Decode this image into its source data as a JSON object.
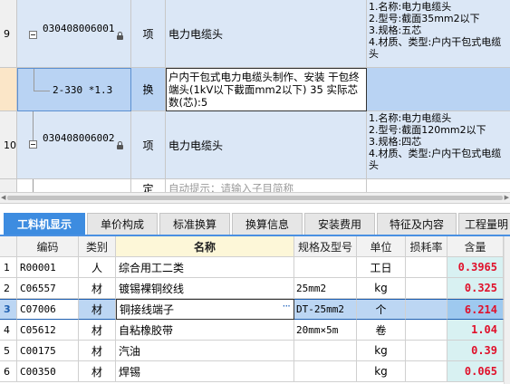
{
  "upper_grid": {
    "rows": [
      {
        "num": "9",
        "code": "030408006001",
        "type": "项",
        "name": "电力电缆头",
        "features": [
          "1.名称:电力电缆头",
          "2.型号:截面35mm2以下",
          "3.规格:五芯",
          "4.材质、类型:户内干包式电缆头"
        ]
      },
      {
        "sub_code": "2-330 *1.3",
        "type": "换",
        "name": "户内干包式电力电缆头制作、安装 干包终端头(1kV以下截面mm2以下) 35 实际芯数(芯):5"
      },
      {
        "num": "10",
        "code": "030408006002",
        "type": "项",
        "name": "电力电缆头",
        "features": [
          "1.名称:电力电缆头",
          "2.型号:截面120mm2以下",
          "3.规格:四芯",
          "4.材质、类型:户内干包式电缆头"
        ]
      },
      {
        "type": "定",
        "name": "自动提示：请输入子目简称"
      }
    ]
  },
  "tabs": [
    {
      "label": "工料机显示",
      "active": true
    },
    {
      "label": "单价构成",
      "active": false
    },
    {
      "label": "标准换算",
      "active": false
    },
    {
      "label": "换算信息",
      "active": false
    },
    {
      "label": "安装费用",
      "active": false
    },
    {
      "label": "特征及内容",
      "active": false
    },
    {
      "label": "工程量明",
      "active": false
    }
  ],
  "lower_grid": {
    "headers": {
      "code": "编码",
      "category": "类别",
      "name": "名称",
      "spec": "规格及型号",
      "unit": "单位",
      "loss": "损耗率",
      "qty": "含量"
    },
    "rows": [
      {
        "num": "1",
        "code": "R00001",
        "category": "人",
        "name": "综合用工二类",
        "spec": "",
        "unit": "工日",
        "loss": "",
        "qty": "0.3965",
        "selected": false
      },
      {
        "num": "2",
        "code": "C06557",
        "category": "材",
        "name": "镀锡裸铜绞线",
        "spec": "25mm2",
        "unit": "kg",
        "loss": "",
        "qty": "0.325",
        "selected": false
      },
      {
        "num": "3",
        "code": "C07006",
        "category": "材",
        "name": "铜接线端子",
        "spec": "DT-25mm2",
        "unit": "个",
        "loss": "",
        "qty": "6.214",
        "selected": true
      },
      {
        "num": "4",
        "code": "C05612",
        "category": "材",
        "name": "自粘橡胶带",
        "spec": "20mm×5m",
        "unit": "卷",
        "loss": "",
        "qty": "1.04",
        "selected": false
      },
      {
        "num": "5",
        "code": "C00175",
        "category": "材",
        "name": "汽油",
        "spec": "",
        "unit": "kg",
        "loss": "",
        "qty": "0.39",
        "selected": false
      },
      {
        "num": "6",
        "code": "C00350",
        "category": "材",
        "name": "焊锡",
        "spec": "",
        "unit": "kg",
        "loss": "",
        "qty": "0.065",
        "selected": false
      }
    ]
  },
  "colors": {
    "accent": "#3d8ce0",
    "quantity_text": "#e0102a",
    "row_highlight": "#dbe7f6"
  }
}
